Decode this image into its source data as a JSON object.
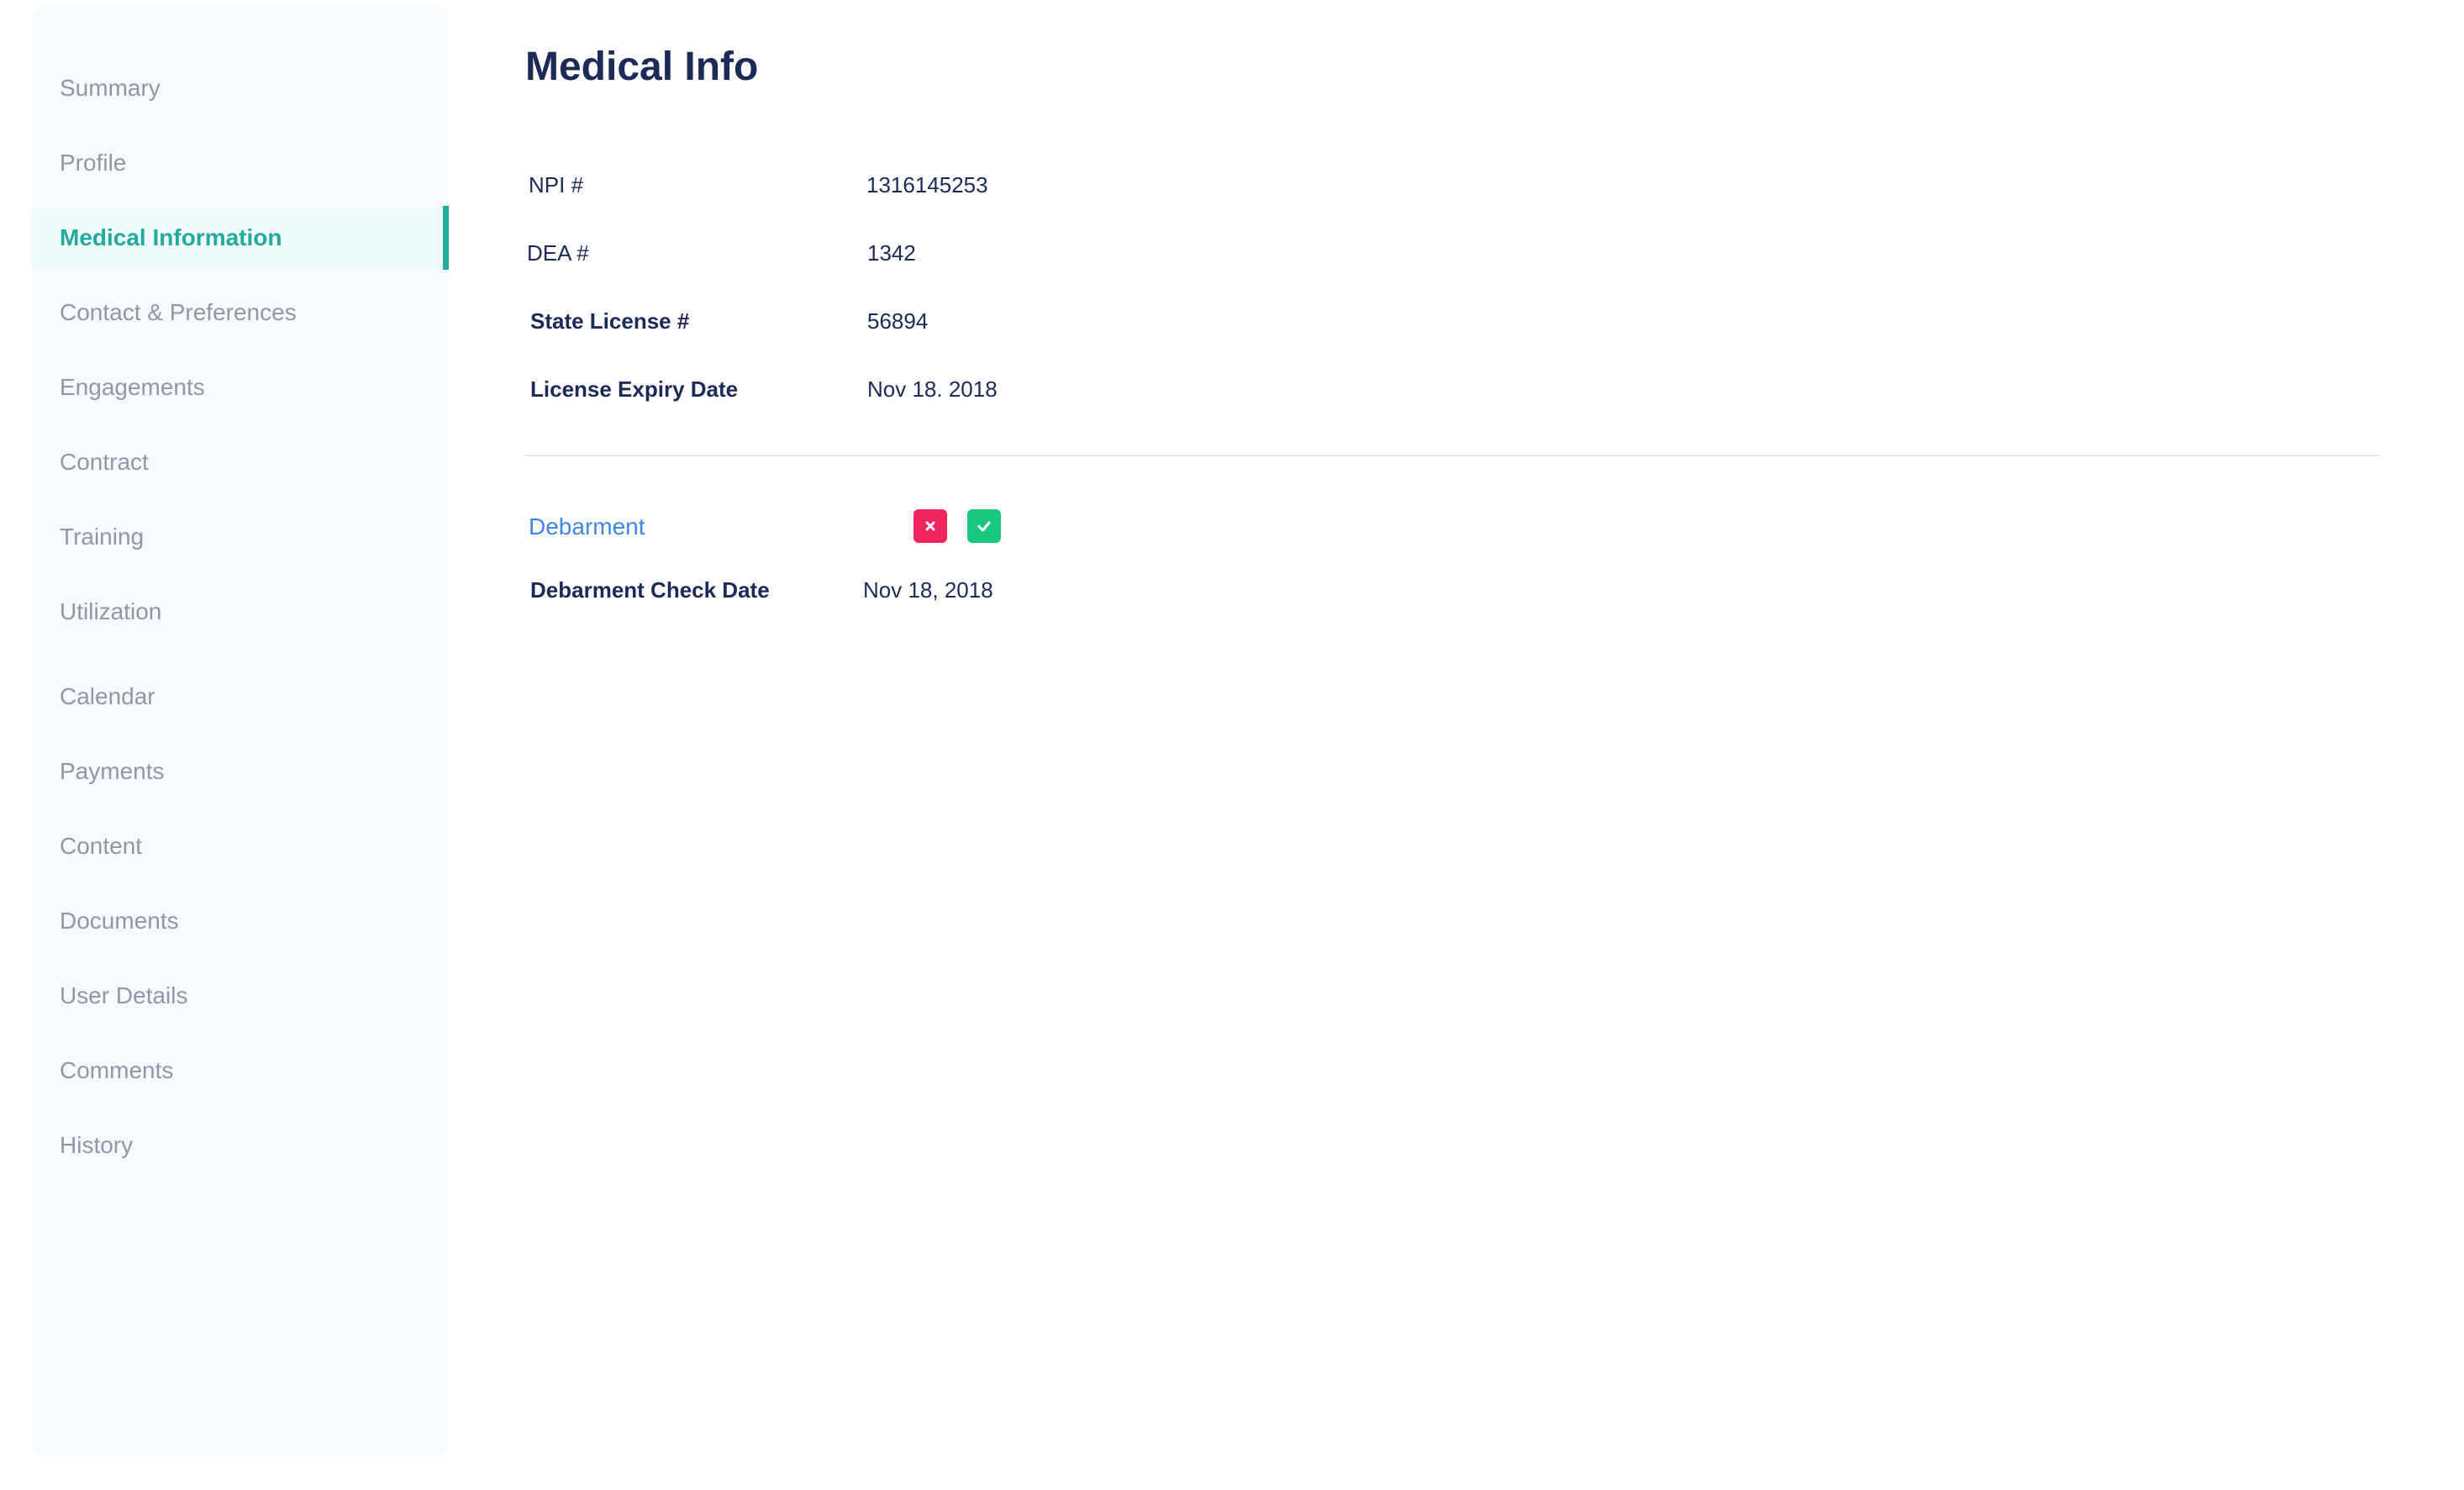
{
  "sidebar": {
    "items": [
      {
        "label": "Summary"
      },
      {
        "label": "Profile"
      },
      {
        "label": "Medical Information"
      },
      {
        "label": "Contact & Preferences"
      },
      {
        "label": "Engagements"
      },
      {
        "label": "Contract"
      },
      {
        "label": "Training"
      },
      {
        "label": "Utilization"
      },
      {
        "label": "Calendar"
      },
      {
        "label": "Payments"
      },
      {
        "label": "Content"
      },
      {
        "label": "Documents"
      },
      {
        "label": "User Details"
      },
      {
        "label": "Comments"
      },
      {
        "label": "History"
      }
    ],
    "active_item": "Medical Information"
  },
  "main": {
    "title": "Medical Info",
    "fields": [
      {
        "label": "NPI #",
        "value": "1316145253"
      },
      {
        "label": "DEA #",
        "value": "1342"
      },
      {
        "label": "State License #",
        "value": "56894"
      },
      {
        "label": "License Expiry Date",
        "value": "Nov 18. 2018"
      }
    ],
    "debarment": {
      "link_label": "Debarment",
      "reject_icon": "close-icon",
      "approve_icon": "check-icon",
      "check_date_label": "Debarment Check Date",
      "check_date_value": "Nov 18, 2018"
    }
  },
  "colors": {
    "accent": "#23aa9e",
    "title": "#1b2a57",
    "muted_nav": "#8f97a8",
    "link": "#3f86e4",
    "reject": "#f0255f",
    "approve": "#19c77f"
  }
}
